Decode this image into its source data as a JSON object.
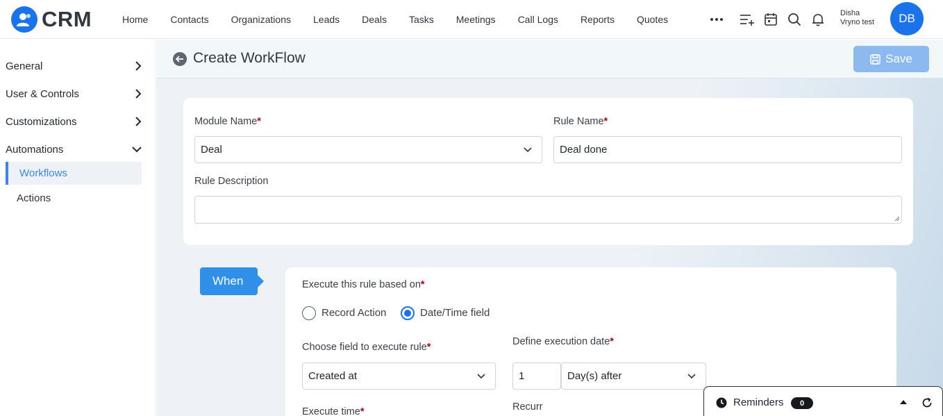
{
  "app": {
    "logo_text": "CRM"
  },
  "nav": {
    "items": [
      "Home",
      "Contacts",
      "Organizations",
      "Leads",
      "Deals",
      "Tasks",
      "Meetings",
      "Call Logs",
      "Reports",
      "Quotes"
    ],
    "more_icon": "more-horizontal-icon",
    "icons": [
      "add-list-icon",
      "calendar-icon",
      "search-icon",
      "bell-icon"
    ]
  },
  "user": {
    "name": "Disha",
    "org": "Vryno test",
    "initials": "DB"
  },
  "sidebar": {
    "items": [
      {
        "label": "General",
        "expanded": false
      },
      {
        "label": "User & Controls",
        "expanded": false
      },
      {
        "label": "Customizations",
        "expanded": false
      },
      {
        "label": "Automations",
        "expanded": true
      }
    ],
    "subitems": [
      {
        "label": "Workflows",
        "active": true
      },
      {
        "label": "Actions",
        "active": false
      }
    ]
  },
  "page": {
    "title": "Create WorkFlow",
    "save_label": "Save"
  },
  "form": {
    "module_name_label": "Module Name",
    "module_name_value": "Deal",
    "rule_name_label": "Rule Name",
    "rule_name_value": "Deal done",
    "rule_description_label": "Rule Description",
    "rule_description_value": ""
  },
  "when": {
    "tag": "When",
    "execute_based_on_label": "Execute this rule based on",
    "options": [
      {
        "label": "Record Action",
        "selected": false
      },
      {
        "label": "Date/Time field",
        "selected": true
      }
    ],
    "choose_field_label": "Choose field to execute rule",
    "choose_field_value": "Created at",
    "define_date_label": "Define execution date",
    "define_date_number": "1",
    "define_date_unit": "Day(s) after",
    "execute_time_label": "Execute time",
    "recurr_label": "Recurr"
  },
  "reminders": {
    "label": "Reminders",
    "count": "0"
  },
  "colors": {
    "primary": "#1a73e8",
    "save_disabled": "#8cb9ef",
    "when_tag": "#2f8fe9",
    "required": "#b0001a"
  }
}
